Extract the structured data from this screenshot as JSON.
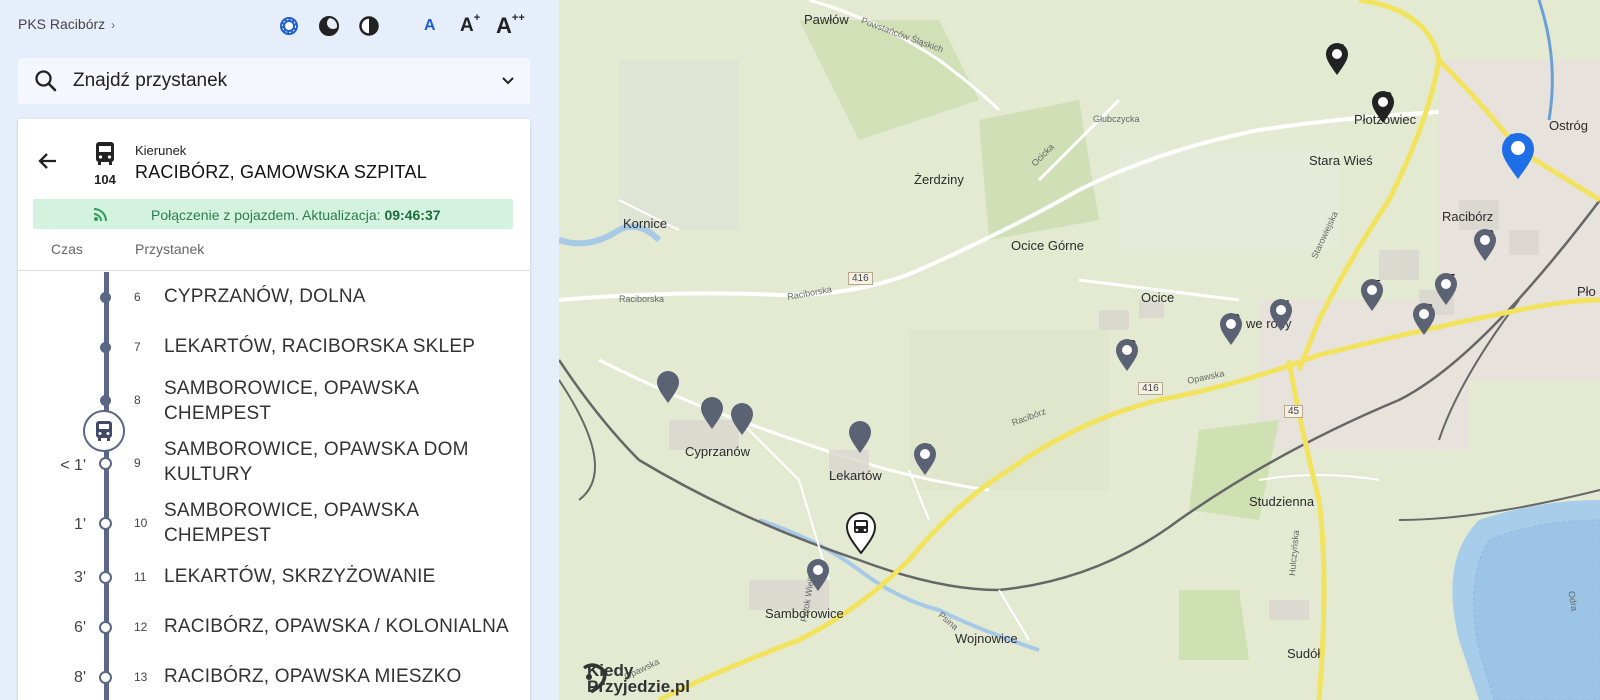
{
  "header": {
    "brand": "PKS Racibórz",
    "brand_chevron": "›",
    "tools": {
      "color_icon": "gear-palette-icon",
      "dark_icon": "moon-icon",
      "contrast_icon": "contrast-icon",
      "font_small": "A",
      "font_medium": "A",
      "font_medium_sup": "+",
      "font_large": "A",
      "font_large_sup": "++"
    }
  },
  "search": {
    "placeholder": "Znajdź przystanek"
  },
  "route": {
    "kierunek_label": "Kierunek",
    "line_number": "104",
    "direction": "RACIBÓRZ, GAMOWSKA SZPITAL",
    "live_message": "Połączenie z pojazdem. Aktualizacja:",
    "live_time": "09:46:37",
    "col_time": "Czas",
    "col_stop": "Przystanek"
  },
  "stops": [
    {
      "num": "6",
      "name": "CYPRZANÓW, DOLNA",
      "time": "",
      "state": "past"
    },
    {
      "num": "7",
      "name": "LEKARTÓW, RACIBORSKA SKLEP",
      "time": "",
      "state": "past"
    },
    {
      "num": "8",
      "name": "SAMBOROWICE, OPAWSKA CHEMPEST",
      "time": "",
      "state": "past"
    },
    {
      "num": "9",
      "name": "SAMBOROWICE, OPAWSKA DOM KULTURY",
      "time": "< 1'",
      "state": "next"
    },
    {
      "num": "10",
      "name": "SAMBOROWICE, OPAWSKA CHEMPEST",
      "time": "1'",
      "state": "next"
    },
    {
      "num": "11",
      "name": "LEKARTÓW, SKRZYŻOWANIE",
      "time": "3'",
      "state": "next"
    },
    {
      "num": "12",
      "name": "RACIBÓRZ, OPAWSKA / KOLONIALNA",
      "time": "6'",
      "state": "next"
    },
    {
      "num": "13",
      "name": "RACIBÓRZ, OPAWSKA MIESZKO",
      "time": "8'",
      "state": "next"
    }
  ],
  "map": {
    "towns": {
      "pawlow": "Pawłów",
      "kornice": "Kornice",
      "zerdziny": "Żerdziny",
      "ocice_gorne": "Ocice Górne",
      "ocice": "Ocice",
      "stara_wies": "Stara Wieś",
      "raciborz": "Racibórz",
      "cyprzanow": "Cyprzanów",
      "lekartow": "Lekartów",
      "samborowice": "Samborowice",
      "wojnowice": "Wojnowice",
      "studzienna": "Studzienna",
      "sudol": "Sudół",
      "ostrog": "Ostróg",
      "plo": "Pło",
      "plotwowiec": "Płotzowiec",
      "nowe_ogrody": "we  rody"
    },
    "roads": {
      "powstancow": "Powstańców Śląskich",
      "glubczycka": "Głubczycka",
      "ocicka": "Ocicka",
      "raciborska1": "Raciborska",
      "raciborska2": "Raciborska",
      "opawska": "Opawska",
      "starowiejska": "Starowiejska",
      "hulczynska": "Hulczyńska",
      "psina": "Psina",
      "odra": "Odra",
      "wojnowicka": "Opawska",
      "raciborz_road": "Racibórz",
      "potok": "Potok Wielkie"
    },
    "shields": {
      "r416a": "416",
      "r416b": "416",
      "r45": "45"
    },
    "pins": [
      "4",
      "5",
      "6",
      "7",
      "9",
      "10",
      "11",
      "12",
      "13",
      "14",
      "15",
      "16",
      "17",
      "18",
      "19",
      "20",
      "21"
    ],
    "logo_line1": "Kiedy",
    "logo_line2": "Przyjedzie.pl"
  },
  "colors": {
    "accent": "#1e5fd1",
    "rail": "#5a6785",
    "live_bg": "#d4f2e0",
    "live_text": "#2e7d4f"
  }
}
